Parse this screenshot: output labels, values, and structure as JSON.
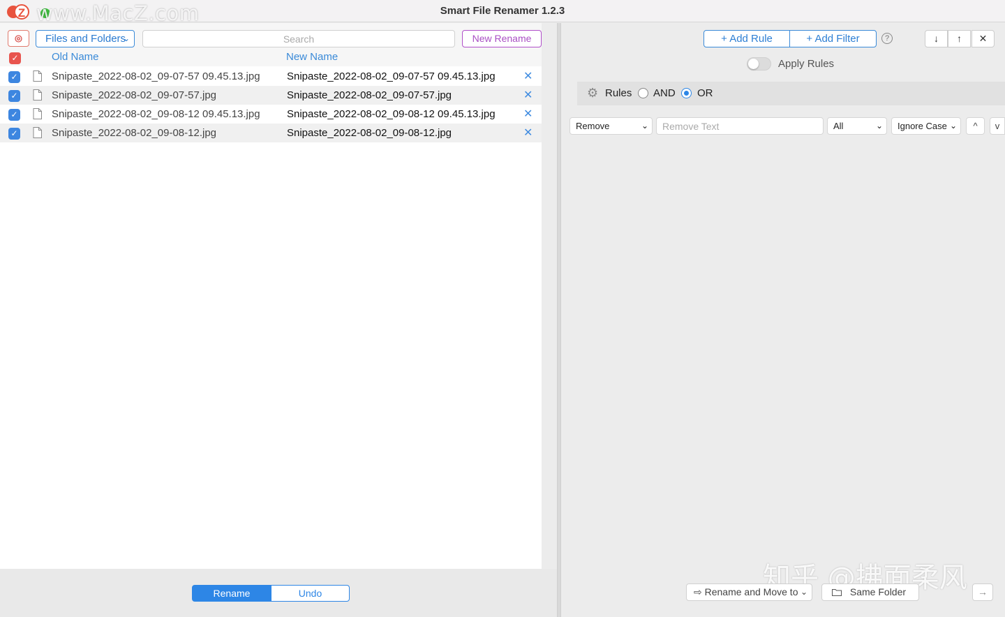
{
  "window": {
    "title": "Smart File Renamer 1.2.3"
  },
  "watermark": {
    "site": "www.MacZ.com",
    "logo_letter": "Z",
    "signature": "知乎 @拂面柔风"
  },
  "left_toolbar": {
    "settings_icon": "gear-icon",
    "scope_select": "Files and Folders",
    "search_placeholder": "Search",
    "new_rename_label": "New Rename"
  },
  "columns": {
    "old_name": "Old Name",
    "new_name": "New Name"
  },
  "files": [
    {
      "checked": true,
      "old": "Snipaste_2022-08-02_09-07-57 09.45.13.jpg",
      "new": "Snipaste_2022-08-02_09-07-57 09.45.13.jpg"
    },
    {
      "checked": true,
      "old": "Snipaste_2022-08-02_09-07-57.jpg",
      "new": "Snipaste_2022-08-02_09-07-57.jpg"
    },
    {
      "checked": true,
      "old": "Snipaste_2022-08-02_09-08-12 09.45.13.jpg",
      "new": "Snipaste_2022-08-02_09-08-12 09.45.13.jpg"
    },
    {
      "checked": true,
      "old": "Snipaste_2022-08-02_09-08-12.jpg",
      "new": "Snipaste_2022-08-02_09-08-12.jpg"
    }
  ],
  "bottom_left": {
    "rename_label": "Rename",
    "undo_label": "Undo"
  },
  "right_toolbar": {
    "add_rule_label": "+ Add Rule",
    "add_filter_label": "+ Add Filter",
    "help": "?",
    "down_arrow": "↓",
    "up_arrow": "↑",
    "close": "✕"
  },
  "apply_rules": {
    "label": "Apply Rules",
    "enabled": false
  },
  "rules_bar": {
    "label": "Rules",
    "and_label": "AND",
    "or_label": "OR",
    "selected": "OR"
  },
  "rule": {
    "action": "Remove",
    "text_placeholder": "Remove Text",
    "scope": "All",
    "case": "Ignore Case",
    "up": "^",
    "down": "v"
  },
  "bottom_right": {
    "move_select": "Rename and Move to",
    "folder_label": "Same Folder",
    "go_arrow": "→"
  },
  "colors": {
    "accent": "#2d86e6",
    "danger": "#e8544e",
    "purple": "#a94fc4"
  }
}
